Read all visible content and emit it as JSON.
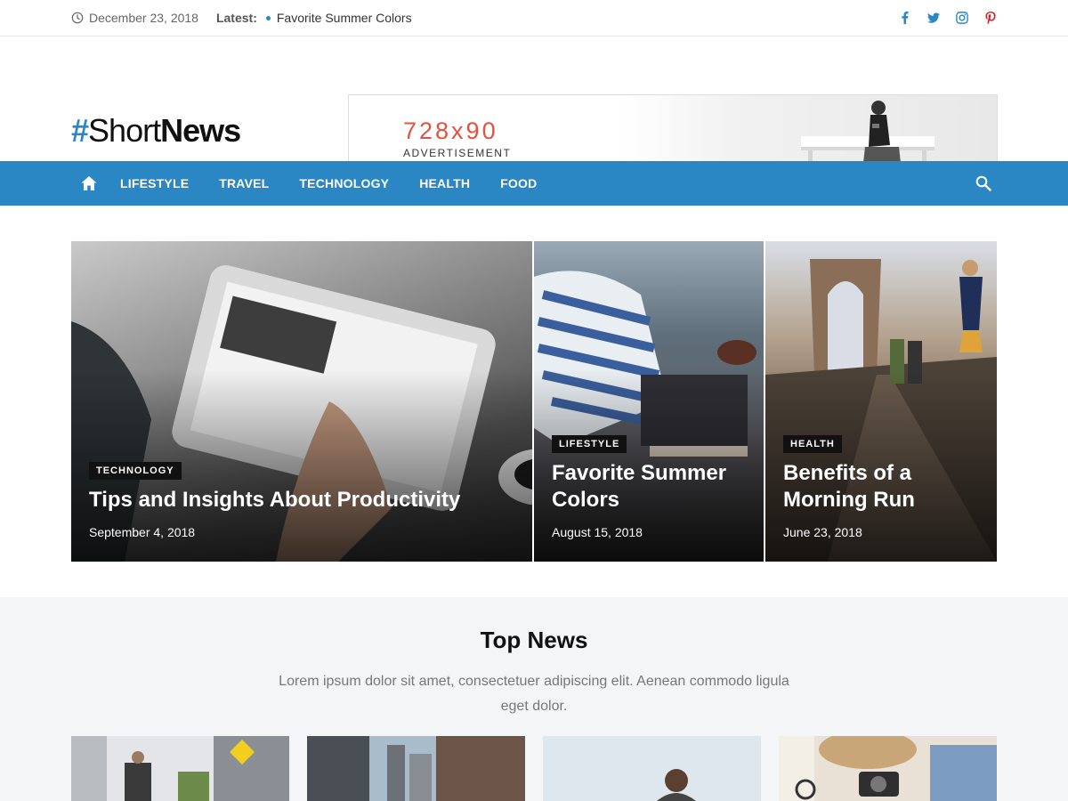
{
  "topbar": {
    "date": "December 23, 2018",
    "latest_label": "Latest:",
    "latest_item": "Favorite Summer Colors",
    "social_icons": [
      "facebook-icon",
      "twitter-icon",
      "instagram-icon",
      "pinterest-icon"
    ]
  },
  "header": {
    "logo_hash": "#",
    "logo_light": "Short",
    "logo_bold": "News",
    "ad_size": "728x90",
    "ad_label": "ADVERTISEMENT"
  },
  "nav": {
    "items": [
      "LIFESTYLE",
      "TRAVEL",
      "TECHNOLOGY",
      "HEALTH",
      "FOOD"
    ]
  },
  "featured": [
    {
      "category": "TECHNOLOGY",
      "title": "Tips and Insights About Productivity",
      "date": "September 4, 2018"
    },
    {
      "category": "LIFESTYLE",
      "title": "Favorite Summer Colors",
      "date": "August 15, 2018"
    },
    {
      "category": "HEALTH",
      "title": "Benefits of a Morning Run",
      "date": "June 23, 2018"
    }
  ],
  "top_news": {
    "title": "Top News",
    "description": "Lorem ipsum dolor sit amet, consectetuer adipiscing elit. Aenean commodo ligula eget dolor."
  },
  "colors": {
    "accent": "#2a87c4",
    "ad_accent": "#e0533f",
    "section_bg": "#f4f5f7"
  }
}
